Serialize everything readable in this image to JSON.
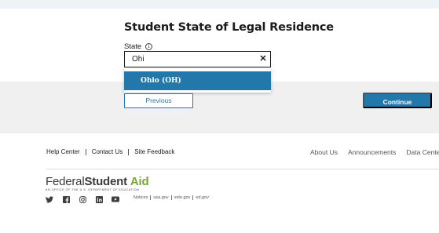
{
  "form": {
    "title": "Student State of Legal Residence",
    "state_label": "State",
    "info_glyph": "i",
    "state_input_value": "Ohi",
    "clear_glyph": "✕"
  },
  "dropdown": {
    "options": [
      {
        "label": "Ohio (OH)",
        "highlighted": true
      }
    ]
  },
  "buttons": {
    "previous": "Previous",
    "continue": "Continue"
  },
  "footer": {
    "left_links": [
      "Help Center",
      "Contact Us",
      "Site Feedback"
    ],
    "right_links": [
      "About Us",
      "Announcements",
      "Data Center"
    ],
    "logo": {
      "word1": "Federal",
      "word2": "Student",
      "word3": "Aid",
      "tagline": "An Office of the U.S. Department of Education"
    },
    "social_icons": [
      "twitter-icon",
      "facebook-icon",
      "instagram-icon",
      "linkedin-icon",
      "youtube-icon"
    ],
    "legal_links": [
      "Notices",
      "usa.gov",
      "vote.gov",
      "ed.gov"
    ]
  },
  "colors": {
    "primary": "#2378ab",
    "brand_green": "#78a53a",
    "band_gray": "#f0f0f0",
    "top_strip": "#eef3f7"
  }
}
